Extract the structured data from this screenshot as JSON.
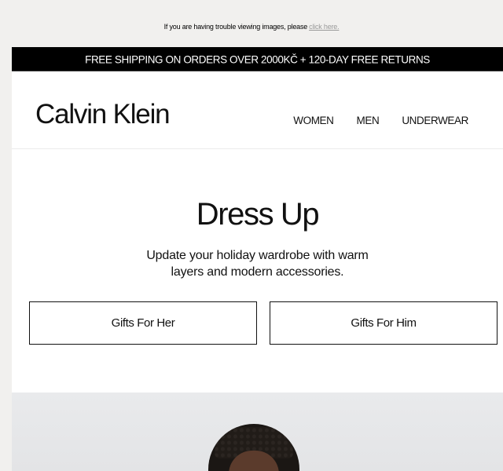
{
  "preheader": {
    "text": "If you are having trouble viewing images, please",
    "link": "click here."
  },
  "promo_bar": {
    "text": "FREE SHIPPING ON ORDERS OVER 2000KČ + 120-DAY FREE RETURNS"
  },
  "header": {
    "logo": "Calvin Klein",
    "nav": [
      "WOMEN",
      "MEN",
      "UNDERWEAR"
    ]
  },
  "hero": {
    "title": "Dress Up",
    "subtitle_line1": "Update your holiday wardrobe with warm",
    "subtitle_line2": "layers and modern accessories.",
    "buttons": [
      "Gifts For Her",
      "Gifts For Him"
    ]
  }
}
